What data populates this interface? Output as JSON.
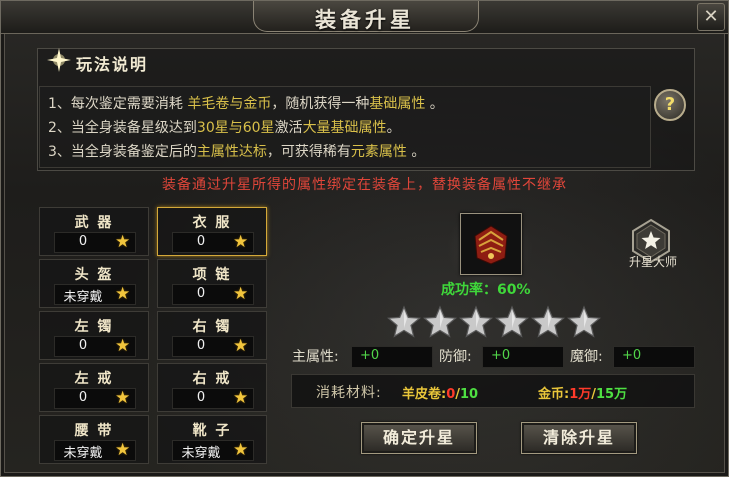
{
  "window": {
    "title": "装备升星",
    "close_glyph": "✕"
  },
  "info": {
    "title": "玩法说明",
    "rules": [
      {
        "a": "1、每次鉴定需要消耗 ",
        "b": "羊毛卷与金币",
        "c": "，随机获得一种",
        "d": "基础属性",
        "e": " 。"
      },
      {
        "a": "2、当全身装备星级达到",
        "b": "30星与60星",
        "c": "激活",
        "d": "大量基础属性",
        "e": "。"
      },
      {
        "a": "3、当全身装备鉴定后的",
        "b": "主属性达标",
        "c": "，可获得稀有",
        "d": "元素属性",
        "e": " 。"
      }
    ],
    "help_glyph": "?"
  },
  "warning": "装备通过升星所得的属性绑定在装备上，替换装备属性不继承",
  "slots": [
    {
      "name": "武 器",
      "value": "0"
    },
    {
      "name": "衣 服",
      "value": "0"
    },
    {
      "name": "头 盔",
      "value": "未穿戴"
    },
    {
      "name": "项 链",
      "value": "0"
    },
    {
      "name": "左 镯",
      "value": "0"
    },
    {
      "name": "右 镯",
      "value": "0"
    },
    {
      "name": "左 戒",
      "value": "0"
    },
    {
      "name": "右 戒",
      "value": "0"
    },
    {
      "name": "腰 带",
      "value": "未穿戴"
    },
    {
      "name": "靴 子",
      "value": "未穿戴"
    }
  ],
  "star_glyph": "★",
  "master_label": "升星大师",
  "success_rate": "成功率：60%",
  "star_rating": {
    "filled": 0,
    "total": 6
  },
  "attributes": {
    "main_label": "主属性:",
    "main_value": "+0",
    "defense_label": "防御:",
    "defense_value": "+0",
    "magic_defense_label": "魔御:",
    "magic_defense_value": "+0"
  },
  "cost": {
    "label": "消耗材料:",
    "material_label": "羊皮卷:",
    "material_have": "0",
    "material_sep": "/",
    "material_need": "10",
    "gold_label": "金币:",
    "gold_have": "1万",
    "gold_sep": "/",
    "gold_need": "15万"
  },
  "buttons": {
    "confirm": "确定升星",
    "clear": "清除升星"
  }
}
